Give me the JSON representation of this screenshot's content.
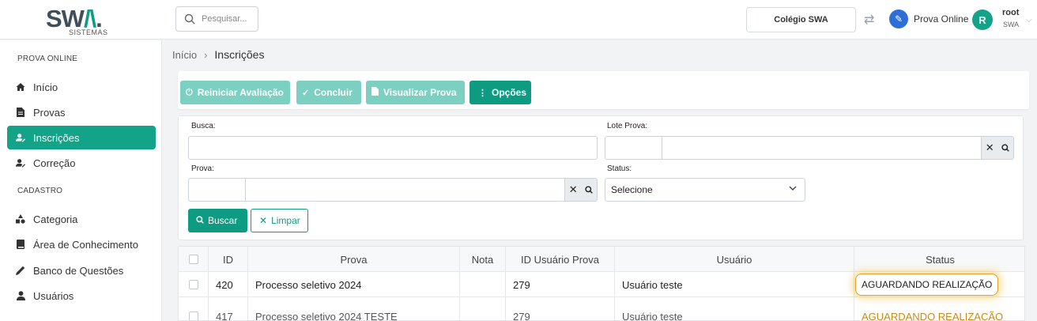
{
  "brand": {
    "name_left": "SW",
    "name_mid": "/\\",
    "name_right": ".",
    "sub": "SISTEMAS"
  },
  "topbar": {
    "search_placeholder": "Pesquisar...",
    "school": "Colégio SWA",
    "module": "Prova Online",
    "user": {
      "initial": "R",
      "name": "root",
      "org": "SWA"
    }
  },
  "sidebar": {
    "section1": "PROVA ONLINE",
    "items1": [
      {
        "label": "Início",
        "icon": "home-icon"
      },
      {
        "label": "Provas",
        "icon": "file-icon"
      },
      {
        "label": "Inscrições",
        "icon": "user-edit-icon",
        "active": true
      },
      {
        "label": "Correção",
        "icon": "user-check-icon"
      }
    ],
    "section2": "CADASTRO",
    "items2": [
      {
        "label": "Categoria",
        "icon": "shapes-icon"
      },
      {
        "label": "Área de Conhecimento",
        "icon": "book-icon"
      },
      {
        "label": "Banco de Questões",
        "icon": "pencil-icon"
      },
      {
        "label": "Usuários",
        "icon": "user-icon"
      }
    ]
  },
  "breadcrumb": {
    "home": "Início",
    "current": "Inscrições"
  },
  "toolbar": {
    "restart": "Reiniciar Avaliação",
    "conclude": "Concluir",
    "view": "Visualizar Prova",
    "options": "Opções"
  },
  "filters": {
    "search_label": "Busca:",
    "lot_label": "Lote Prova:",
    "exam_label": "Prova:",
    "status_label": "Status:",
    "status_value": "Selecione",
    "search_button": "Buscar",
    "clear_button": "Limpar"
  },
  "table": {
    "headers": [
      "ID",
      "Prova",
      "Nota",
      "ID Usuário Prova",
      "Usuário",
      "Status"
    ],
    "rows": [
      {
        "id": "420",
        "prova": "Processo seletivo 2024",
        "nota": "",
        "id_usuario_prova": "279",
        "usuario": "Usuário teste",
        "status": "AGUARDANDO REALIZAÇÃO"
      },
      {
        "id": "417",
        "prova": "Processo seletivo 2024 TESTE",
        "nota": "",
        "id_usuario_prova": "279",
        "usuario": "Usuário teste",
        "status": "AGUARDANDO REALIZAÇÃO"
      }
    ]
  },
  "colors": {
    "accent": "#12a389",
    "accent_dark": "#0d9c82",
    "status_border": "#e2a02b"
  }
}
